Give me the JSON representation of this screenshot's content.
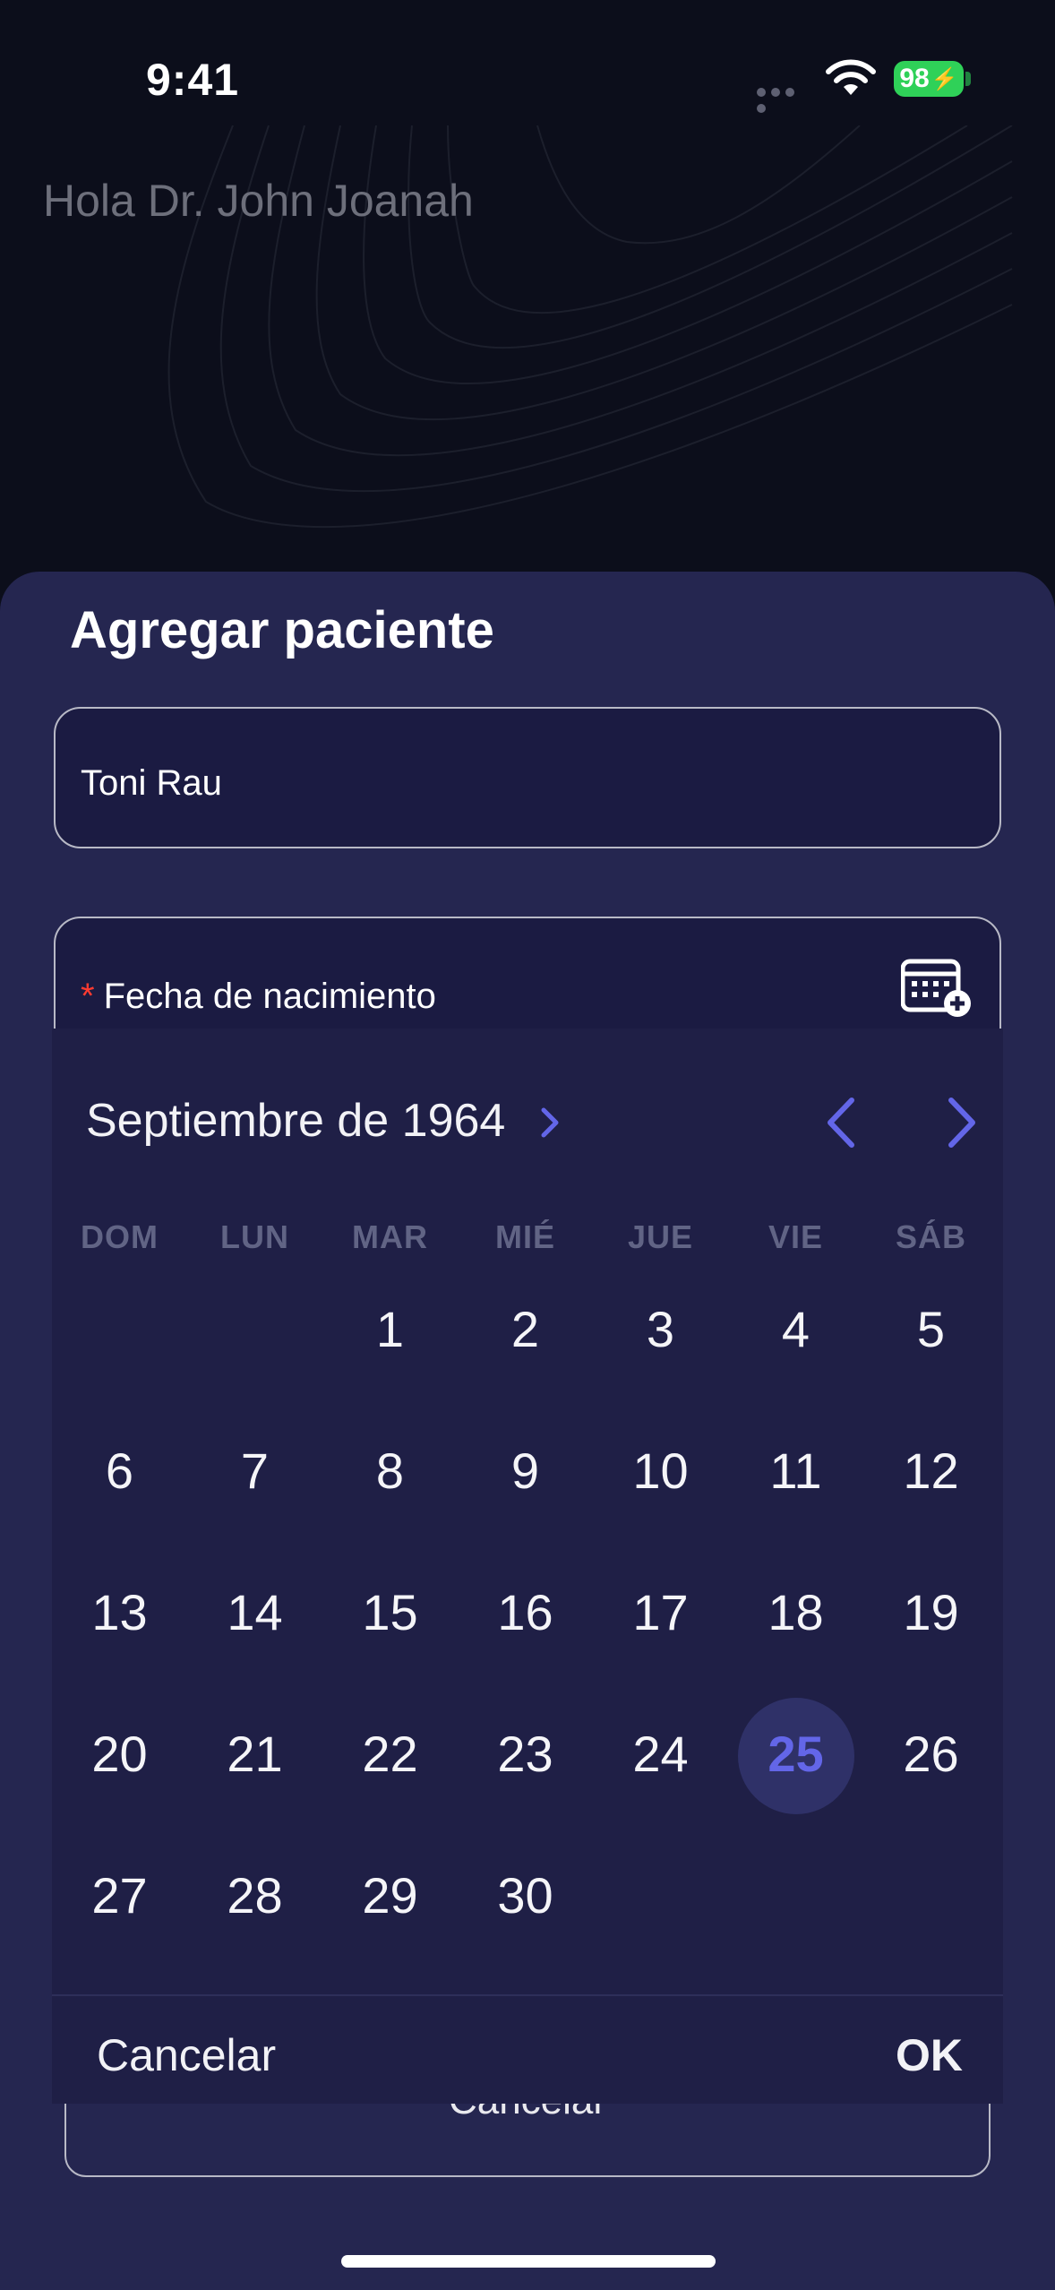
{
  "status_bar": {
    "time": "9:41",
    "battery": "98"
  },
  "header": {
    "greeting": "Hola Dr. John Joanah"
  },
  "sheet": {
    "title": "Agregar paciente",
    "name_field": {
      "value": "Toni Rau"
    },
    "birthdate_field": {
      "required_mark": "*",
      "label": "Fecha de nacimiento",
      "icon": "calendar-add-icon"
    },
    "cancel_label": "Cancelar"
  },
  "date_picker": {
    "month_label": "Septiembre de 1964",
    "weekdays": [
      "DOM",
      "LUN",
      "MAR",
      "MIÉ",
      "JUE",
      "VIE",
      "SÁB"
    ],
    "days": [
      "1",
      "2",
      "3",
      "4",
      "5",
      "6",
      "7",
      "8",
      "9",
      "10",
      "11",
      "12",
      "13",
      "14",
      "15",
      "16",
      "17",
      "18",
      "19",
      "20",
      "21",
      "22",
      "23",
      "24",
      "25",
      "26",
      "27",
      "28",
      "29",
      "30"
    ],
    "first_weekday_index": 2,
    "selected_day": "25",
    "cancel_label": "Cancelar",
    "ok_label": "OK"
  },
  "colors": {
    "accent": "#6366e8",
    "sheet": "#252650",
    "picker": "#1f1f46"
  }
}
